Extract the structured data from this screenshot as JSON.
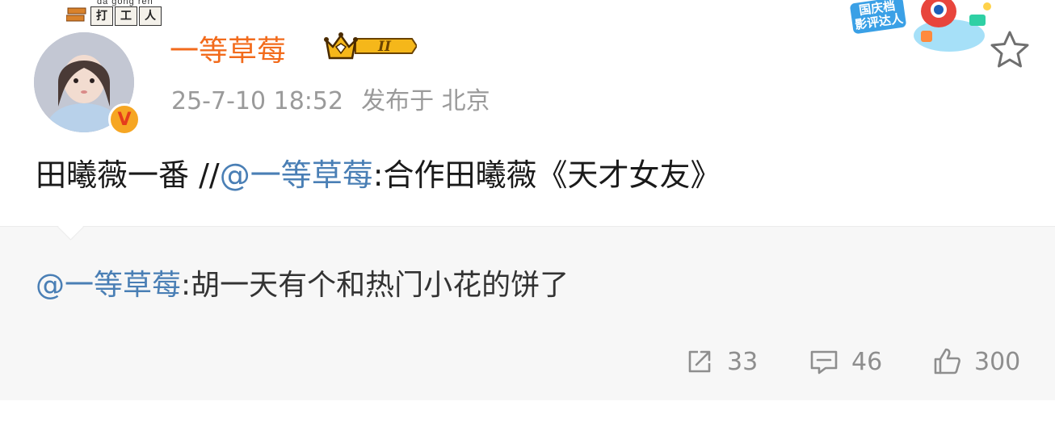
{
  "user": {
    "name": "一等草莓",
    "vip_level": "II",
    "avatar_badge": {
      "pinyin": "da gong ren",
      "chars": [
        "打",
        "工",
        "人"
      ]
    },
    "verified_mark": "V"
  },
  "meta": {
    "time": "25-7-10 18:52",
    "location": "发布于 北京"
  },
  "festival_badge": {
    "line1": "国庆档",
    "line2": "影评达人"
  },
  "post": {
    "text_before": "田曦薇一番 //",
    "mention": "@一等草莓",
    "text_after": ":合作田曦薇《天才女友》"
  },
  "repost": {
    "mention": "@一等草莓",
    "text": ":胡一天有个和热门小花的饼了"
  },
  "stats": {
    "shares": "33",
    "comments": "46",
    "likes": "300"
  },
  "colors": {
    "username": "#f26b1c",
    "mention": "#4a7fb5",
    "meta": "#9a9a9a",
    "repost_bg": "#f7f7f7"
  },
  "icons": [
    "brick-icon",
    "verified-icon",
    "crown-icon",
    "star-icon",
    "share-icon",
    "comment-icon",
    "like-icon"
  ]
}
